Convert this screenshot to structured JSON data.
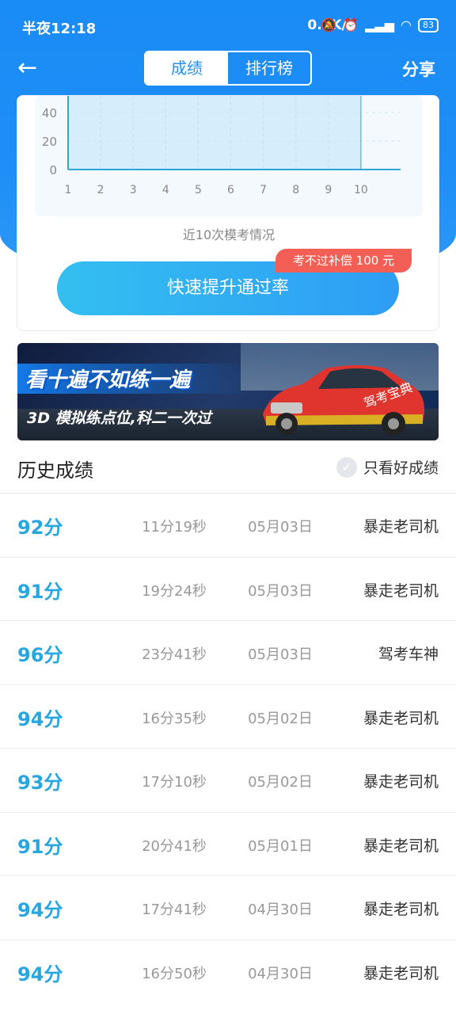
{
  "status_bar": {
    "time": "半夜12:18",
    "network_speed": "0.0K/s",
    "battery": "83"
  },
  "nav": {
    "tabs": [
      {
        "label": "成绩",
        "active": true
      },
      {
        "label": "排行榜",
        "active": false
      }
    ],
    "share_label": "分享"
  },
  "chart_data": {
    "type": "area",
    "x": [
      1,
      2,
      3,
      4,
      5,
      6,
      7,
      8,
      9,
      10
    ],
    "y_ticks": [
      "40",
      "20",
      "0"
    ],
    "x_tick_labels": [
      "1",
      "2",
      "3",
      "4",
      "5",
      "6",
      "7",
      "8",
      "9",
      "10"
    ]
  },
  "chart_caption": "近10次模考情况",
  "cta": {
    "label": "快速提升通过率",
    "badge": "考不过补偿 100 元"
  },
  "banner": {
    "headline": "看十遍不如练一遍",
    "subline": "3D 模拟练点位,科二一次过",
    "car_brand_text": "驾考宝典"
  },
  "history": {
    "title": "历史成绩",
    "filter_label": "只看好成绩",
    "rows": [
      {
        "score": "92分",
        "duration": "11分19秒",
        "date": "05月03日",
        "user": "暴走老司机"
      },
      {
        "score": "91分",
        "duration": "19分24秒",
        "date": "05月03日",
        "user": "暴走老司机"
      },
      {
        "score": "96分",
        "duration": "23分41秒",
        "date": "05月03日",
        "user": "驾考车神"
      },
      {
        "score": "94分",
        "duration": "16分35秒",
        "date": "05月02日",
        "user": "暴走老司机"
      },
      {
        "score": "93分",
        "duration": "17分10秒",
        "date": "05月02日",
        "user": "暴走老司机"
      },
      {
        "score": "91分",
        "duration": "20分41秒",
        "date": "05月01日",
        "user": "暴走老司机"
      },
      {
        "score": "94分",
        "duration": "17分41秒",
        "date": "04月30日",
        "user": "暴走老司机"
      },
      {
        "score": "94分",
        "duration": "16分50秒",
        "date": "04月30日",
        "user": "暴走老司机"
      }
    ]
  },
  "colors": {
    "primary_blue": "#1f8ef6",
    "score_blue": "#28a6df",
    "badge_red": "#f35e55"
  }
}
